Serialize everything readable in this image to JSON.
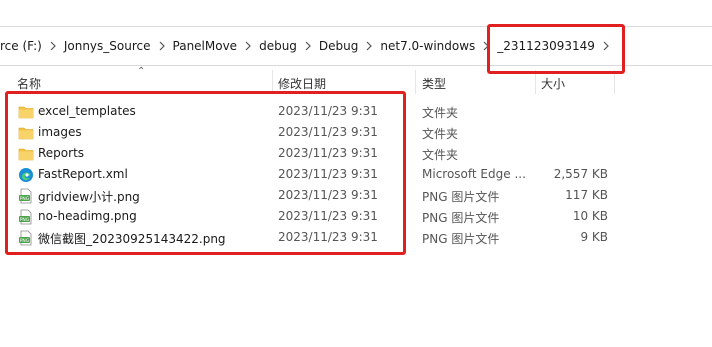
{
  "breadcrumb": {
    "items": [
      "rce (F:)",
      "Jonnys_Source",
      "PanelMove",
      "debug",
      "Debug",
      "net7.0-windows",
      "_231123093149"
    ]
  },
  "columns": {
    "name": "名称",
    "date": "修改日期",
    "type": "类型",
    "size": "大小"
  },
  "files": [
    {
      "name": "excel_templates",
      "date": "2023/11/23 9:31",
      "type": "文件夹",
      "size": "",
      "icon": "folder-icon"
    },
    {
      "name": "images",
      "date": "2023/11/23 9:31",
      "type": "文件夹",
      "size": "",
      "icon": "folder-icon"
    },
    {
      "name": "Reports",
      "date": "2023/11/23 9:31",
      "type": "文件夹",
      "size": "",
      "icon": "folder-icon"
    },
    {
      "name": "FastReport.xml",
      "date": "2023/11/23 9:31",
      "type": "Microsoft Edge ...",
      "size": "2,557 KB",
      "icon": "edge-icon"
    },
    {
      "name": "gridview小计.png",
      "date": "2023/11/23 9:31",
      "type": "PNG 图片文件",
      "size": "117 KB",
      "icon": "png-file-icon"
    },
    {
      "name": "no-headimg.png",
      "date": "2023/11/23 9:31",
      "type": "PNG 图片文件",
      "size": "10 KB",
      "icon": "png-file-icon"
    },
    {
      "name": "微信截图_20230925143422.png",
      "date": "2023/11/23 9:31",
      "type": "PNG 图片文件",
      "size": "9 KB",
      "icon": "png-file-icon"
    }
  ],
  "colors": {
    "annotation": "#e02020",
    "folder": "#f5c342",
    "edge": "#1a8fd6",
    "png": "#4aa34a"
  }
}
